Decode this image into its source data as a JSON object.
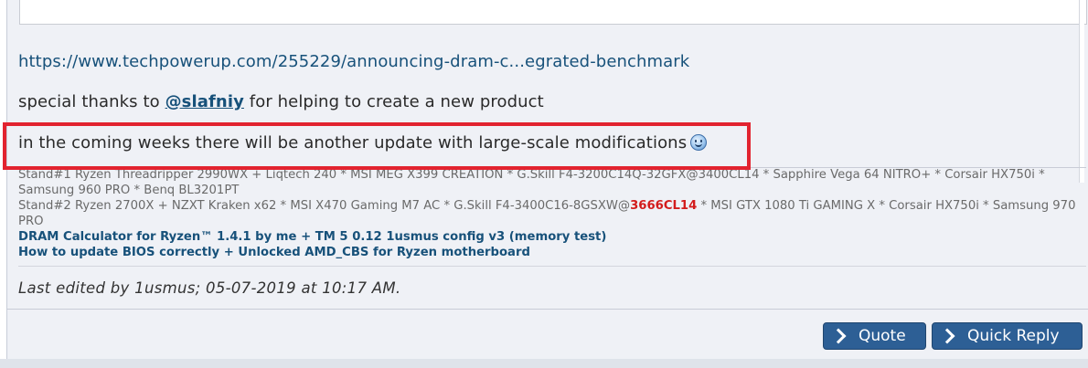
{
  "quote_box": {
    "faint_text": "··· ···"
  },
  "post": {
    "link": "https://www.techpowerup.com/255229/announcing-dram-c...egrated-benchmark",
    "thanks_prefix": "special thanks to ",
    "thanks_mention": "@slafniy",
    "thanks_suffix": " for helping to create a new product",
    "update_text": "in the coming weeks there will be another update with large-scale modifications"
  },
  "signature": {
    "stand1_label": "Stand#1",
    "stand1_text": " Ryzen Threadripper 2990WX + Liqtech 240 * MSI MEG X399 CREATION * G.Skill F4-3200C14Q-32GFX@3400CL14 * Sapphire Vega 64 NITRO+ * Corsair HX750i * Samsung 960 PRO * Benq BL3201PT",
    "stand2_label": "Stand#2",
    "stand2_text_before": " Ryzen 2700X + NZXT Kraken x62 * MSI X470 Gaming M7 AC * G.Skill F4-3400C16-8GSXW@",
    "stand2_highlight": "3666CL14",
    "stand2_text_after": " * MSI GTX 1080 Ti GAMING X * Corsair HX750i * Samsung 970 PRO",
    "link1": "DRAM Calculator for Ryzen™ 1.4.1 by me + TM 5 0.12 1usmus config v3 (memory test)",
    "link2": "How to update BIOS correctly + Unlocked AMD_CBS for Ryzen motherboard"
  },
  "edited": "Last edited by 1usmus; 05-07-2019 at 10:17 AM.",
  "buttons": {
    "quote": "Quote",
    "quick_reply": "Quick Reply"
  },
  "colors": {
    "accent_blue": "#17517a",
    "button_blue": "#2d5f95",
    "highlight_red": "#e2232f"
  }
}
